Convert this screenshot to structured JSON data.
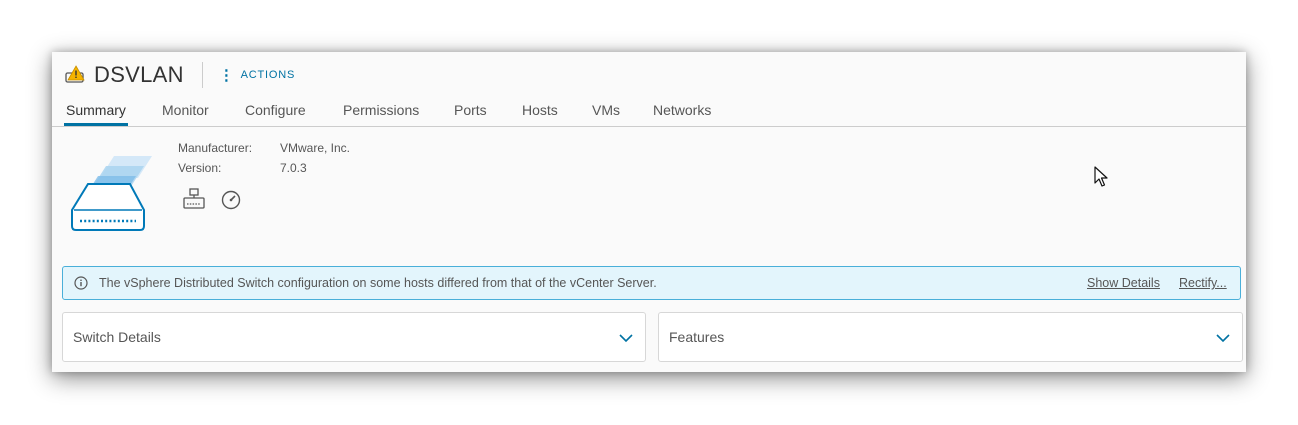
{
  "header": {
    "title": "DSVLAN",
    "actions_label": "ACTIONS",
    "title_icon": "warning-switch-icon"
  },
  "tabs": [
    {
      "label": "Summary",
      "active": true
    },
    {
      "label": "Monitor"
    },
    {
      "label": "Configure"
    },
    {
      "label": "Permissions"
    },
    {
      "label": "Ports"
    },
    {
      "label": "Hosts"
    },
    {
      "label": "VMs"
    },
    {
      "label": "Networks"
    }
  ],
  "summary": {
    "manufacturer_label": "Manufacturer:",
    "manufacturer_value": "VMware, Inc.",
    "version_label": "Version:",
    "version_value": "7.0.3"
  },
  "banner": {
    "message": "The vSphere Distributed Switch configuration on some hosts differed from that of the vCenter Server.",
    "show_details": "Show Details",
    "rectify": "Rectify..."
  },
  "cards": {
    "switch_details": "Switch Details",
    "features": "Features"
  },
  "colors": {
    "accent": "#0072a3",
    "banner_bg": "#e3f5fc",
    "banner_border": "#49afd9",
    "warning": "#f5b400"
  }
}
